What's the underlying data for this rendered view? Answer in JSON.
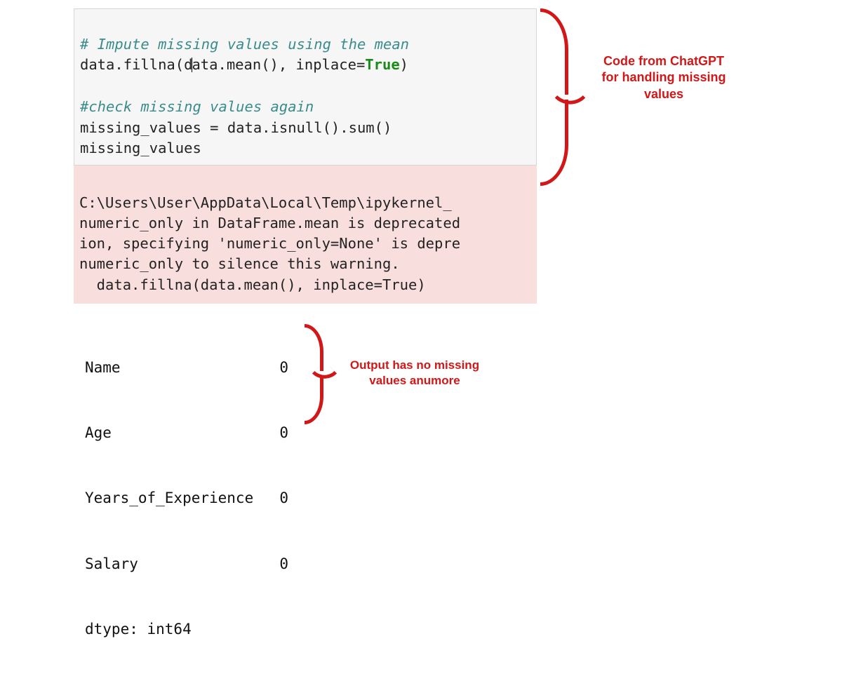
{
  "code": {
    "comment1": "# Impute missing values using the mean",
    "line2_a": "data.fillna(d",
    "line2_b": "ata.mean(), inplace=",
    "true": "True",
    "line2_c": ")",
    "blank": "",
    "comment2": "#check missing values again",
    "line4": "missing_values = data.isnull().sum()",
    "line5": "missing_values"
  },
  "warning": {
    "l1": "C:\\Users\\User\\AppData\\Local\\Temp\\ipykernel_",
    "l2": "numeric_only in DataFrame.mean is deprecated",
    "l3": "ion, specifying 'numeric_only=None' is depre",
    "l4": "numeric_only to silence this warning.",
    "l5": "  data.fillna(data.mean(), inplace=True)"
  },
  "output": {
    "rows": [
      {
        "k": "Name",
        "v": "0"
      },
      {
        "k": "Age",
        "v": "0"
      },
      {
        "k": "Years_of_Experience",
        "v": "0"
      },
      {
        "k": "Salary",
        "v": "0"
      }
    ],
    "dtype": "dtype: int64"
  },
  "annotations": {
    "top1": "Code from ChatGPT",
    "top2": "for handling missing",
    "top3": "values",
    "bot1": "Output has no missing",
    "bot2": "values anumore"
  }
}
